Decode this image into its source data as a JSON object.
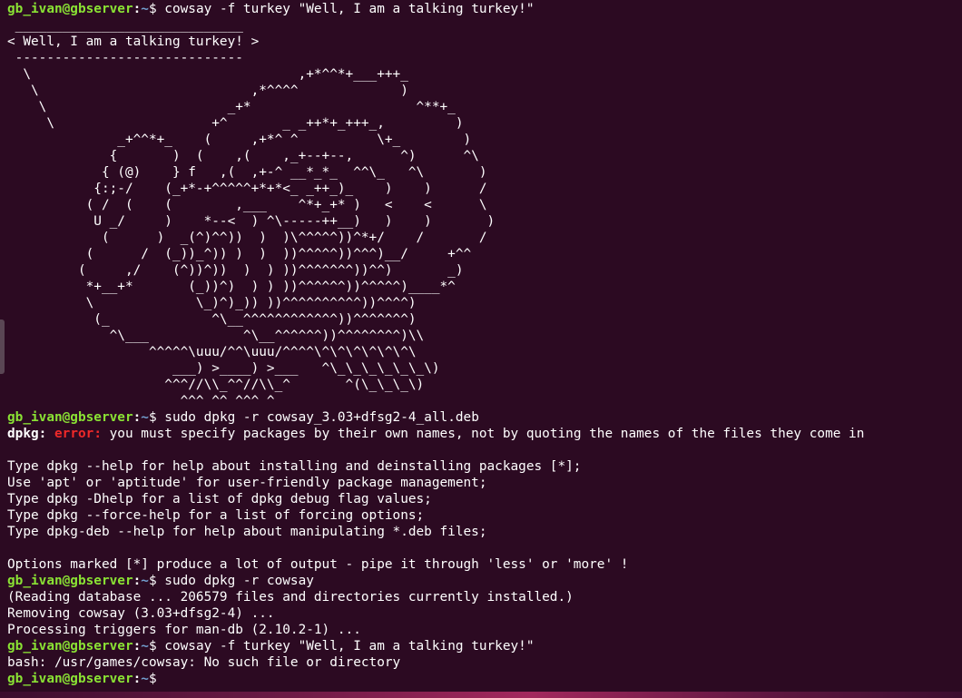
{
  "prompt": {
    "user_host": "gb_ivan@gbserver",
    "separator": ":",
    "path": "~",
    "symbol": "$ "
  },
  "session": {
    "cmd1": "cowsay -f turkey \"Well, I am a talking turkey!\"",
    "cowsay_output": [
      " _____________________________",
      "< Well, I am a talking turkey! >",
      " -----------------------------",
      "  \\                                  ,+*^^*+___+++_",
      "   \\                           ,*^^^^             )",
      "    \\                       _+*                     ^**+_",
      "     \\                    +^       _ _++*+_+++_,         )",
      "              _+^^*+_    (     ,+*^ ^          \\+_        )",
      "             {       )  (    ,(    ,_+--+--,      ^)      ^\\",
      "            { (@)    } f   ,(  ,+-^ __*_*_  ^^\\_   ^\\       )",
      "           {:;-/    (_+*-+^^^^^+*+*<_ _++_)_    )    )      /",
      "          ( /  (    (        ,___    ^*+_+* )   <    <      \\",
      "           U _/     )    *--<  ) ^\\-----++__)   )    )       )",
      "            (      )  _(^)^^))  )  )\\^^^^^))^*+/    /       /",
      "          (      /  (_))_^)) )  )  ))^^^^^))^^^)__/     +^^",
      "         (     ,/    (^))^))  )  ) ))^^^^^^^))^^)       _)",
      "          *+__+*       (_))^)  ) ) ))^^^^^^))^^^^^)____*^",
      "          \\             \\_)^)_)) ))^^^^^^^^^^))^^^^)",
      "           (_             ^\\__^^^^^^^^^^^^))^^^^^^^)",
      "             ^\\___            ^\\__^^^^^^))^^^^^^^^)\\\\",
      "                  ^^^^^\\uuu/^^\\uuu/^^^^\\^\\^\\^\\^\\^\\^\\",
      "                     ___) >____) >___   ^\\_\\_\\_\\_\\_\\_\\)",
      "                    ^^^//\\\\_^^//\\\\_^       ^(\\_\\_\\_\\)",
      "                      ^^^ ^^ ^^^ ^"
    ],
    "cmd2": "sudo dpkg -r cowsay_3.03+dfsg2-4_all.deb",
    "dpkg_label": "dpkg:",
    "error_label": "error:",
    "error_text": " you must specify packages by their own names, not by quoting the names of the files they come in",
    "help_lines": [
      "",
      "Type dpkg --help for help about installing and deinstalling packages [*];",
      "Use 'apt' or 'aptitude' for user-friendly package management;",
      "Type dpkg -Dhelp for a list of dpkg debug flag values;",
      "Type dpkg --force-help for a list of forcing options;",
      "Type dpkg-deb --help for help about manipulating *.deb files;",
      "",
      "Options marked [*] produce a lot of output - pipe it through 'less' or 'more' !"
    ],
    "cmd3": "sudo dpkg -r cowsay",
    "remove_output": [
      "(Reading database ... 206579 files and directories currently installed.)",
      "Removing cowsay (3.03+dfsg2-4) ...",
      "Processing triggers for man-db (2.10.2-1) ..."
    ],
    "cmd4": "cowsay -f turkey \"Well, I am a talking turkey!\"",
    "bash_error": "bash: /usr/games/cowsay: No such file or directory",
    "cmd5": ""
  },
  "colors": {
    "background": "#2c0a22",
    "prompt_user": "#8ae234",
    "prompt_path": "#729fcf",
    "error": "#ef2929",
    "text": "#ffffff"
  }
}
